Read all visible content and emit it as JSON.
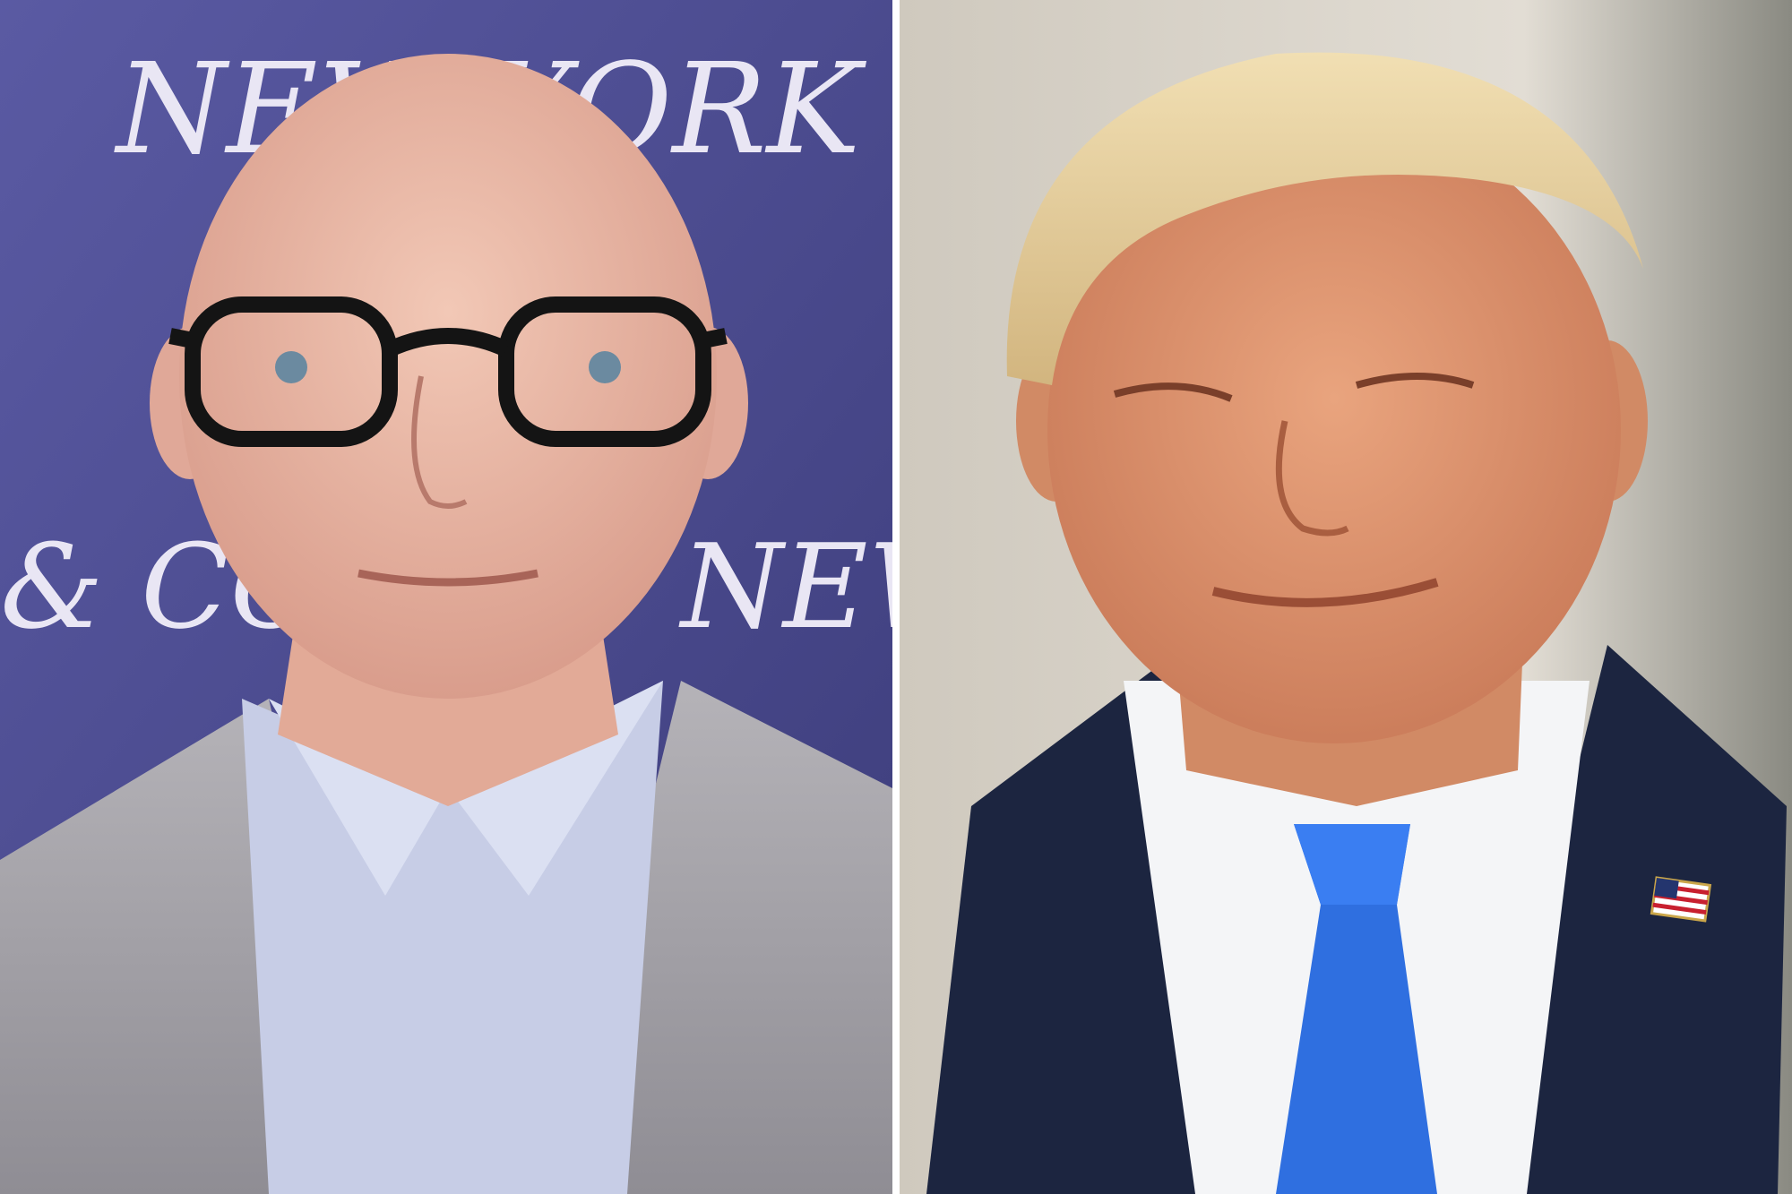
{
  "backdrop_text": {
    "top": "NEW YORK",
    "left_bottom": "& CO",
    "right_bottom": "NEW"
  },
  "colors": {
    "left_backdrop": "#4a4a8c",
    "right_backdrop": "#d9d4cb",
    "divider": "#ffffff",
    "tie": "#2f6fe0",
    "suit_navy": "#1c2540",
    "jacket_grey": "#a9a7ad"
  },
  "icons": {
    "lapel_pin": "us-flag-pin-icon"
  }
}
